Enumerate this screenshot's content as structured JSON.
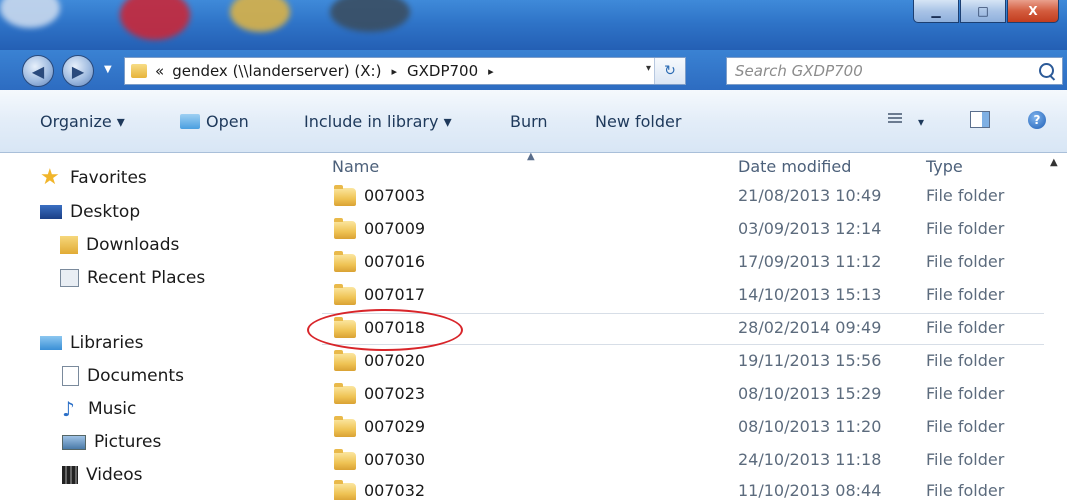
{
  "window": {
    "minimize": "▁",
    "maximize": "□",
    "close": "X"
  },
  "address": {
    "overflow": "«",
    "crumbs": [
      "gendex (\\\\landerserver) (X:)",
      "GXDP700"
    ],
    "sep": "▸",
    "dropdown": "▾",
    "refresh": "↻"
  },
  "search": {
    "placeholder": "Search GXDP700"
  },
  "toolbar": {
    "organize": "Organize ▾",
    "open": "Open",
    "include_in_library": "Include in library ▾",
    "burn": "Burn",
    "new_folder": "New folder",
    "view_dropdown": "▾",
    "help": "?"
  },
  "nav": {
    "favorites": "Favorites",
    "desktop": "Desktop",
    "downloads": "Downloads",
    "recent_places": "Recent Places",
    "libraries": "Libraries",
    "documents": "Documents",
    "music": "Music",
    "pictures": "Pictures",
    "videos": "Videos"
  },
  "columns": {
    "name": "Name",
    "date": "Date modified",
    "type": "Type",
    "sort": "▲"
  },
  "files": [
    {
      "name": "007003",
      "date": "21/08/2013 10:49",
      "type": "File folder"
    },
    {
      "name": "007009",
      "date": "03/09/2013 12:14",
      "type": "File folder"
    },
    {
      "name": "007016",
      "date": "17/09/2013 11:12",
      "type": "File folder"
    },
    {
      "name": "007017",
      "date": "14/10/2013 15:13",
      "type": "File folder"
    },
    {
      "name": "007018",
      "date": "28/02/2014 09:49",
      "type": "File folder"
    },
    {
      "name": "007020",
      "date": "19/11/2013 15:56",
      "type": "File folder"
    },
    {
      "name": "007023",
      "date": "08/10/2013 15:29",
      "type": "File folder"
    },
    {
      "name": "007029",
      "date": "08/10/2013 11:20",
      "type": "File folder"
    },
    {
      "name": "007030",
      "date": "24/10/2013 11:18",
      "type": "File folder"
    },
    {
      "name": "007032",
      "date": "11/10/2013 08:44",
      "type": "File folder"
    }
  ],
  "colors": {
    "accent": "#2f74c8",
    "highlight_circle": "#d8252a"
  }
}
